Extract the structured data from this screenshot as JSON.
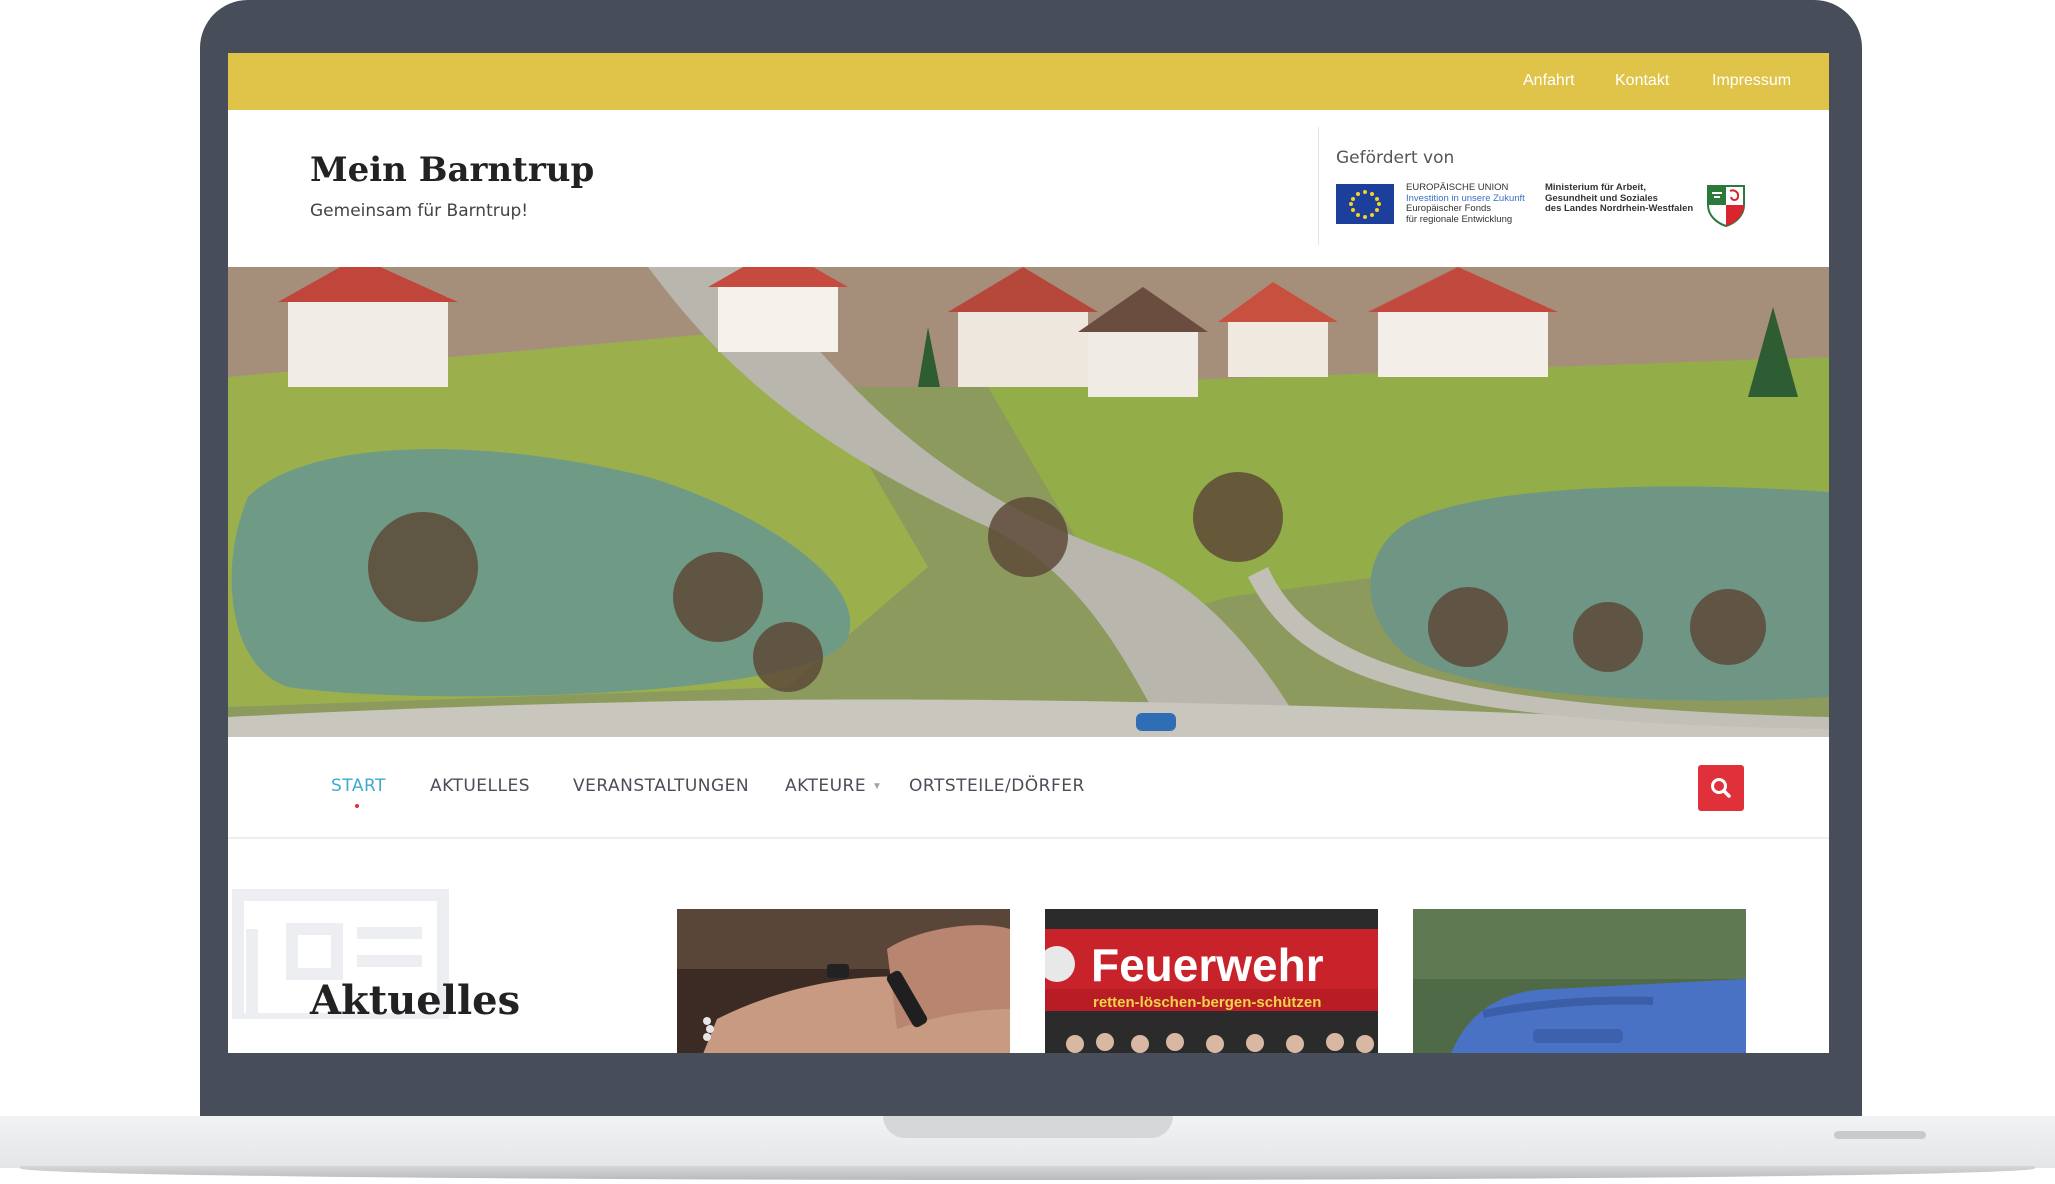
{
  "topbar": {
    "links": [
      "Anfahrt",
      "Kontakt",
      "Impressum"
    ],
    "color": "#e0c44a"
  },
  "site": {
    "title": "Mein Barntrup",
    "tagline": "Gemeinsam für Barntrup!"
  },
  "funding": {
    "label": "Gefördert von",
    "eu_lines": [
      "EUROPÄISCHE UNION",
      "Investition in unsere Zukunft",
      "Europäischer Fonds",
      "für regionale Entwicklung"
    ],
    "nrw_lines": [
      "Ministerium für Arbeit,",
      "Gesundheit und Soziales",
      "des Landes Nordrhein-Westfalen"
    ]
  },
  "nav": {
    "items": [
      "START",
      "AKTUELLES",
      "VERANSTALTUNGEN",
      "AKTEURE",
      "ORTSTEILE/DÖRFER"
    ],
    "active": "START",
    "active_color": "#3daad0",
    "search_icon": "search-icon",
    "search_color": "#e0313b"
  },
  "content": {
    "section_title": "Aktuelles",
    "cards": [
      {
        "image": "hands-stacked-photo"
      },
      {
        "image": "feuerwehr-group-photo",
        "sign_text": "Feuerwehr",
        "sign_subtext": "retten-löschen-bergen-schützen"
      },
      {
        "image": "blue-bin-photo"
      }
    ]
  }
}
